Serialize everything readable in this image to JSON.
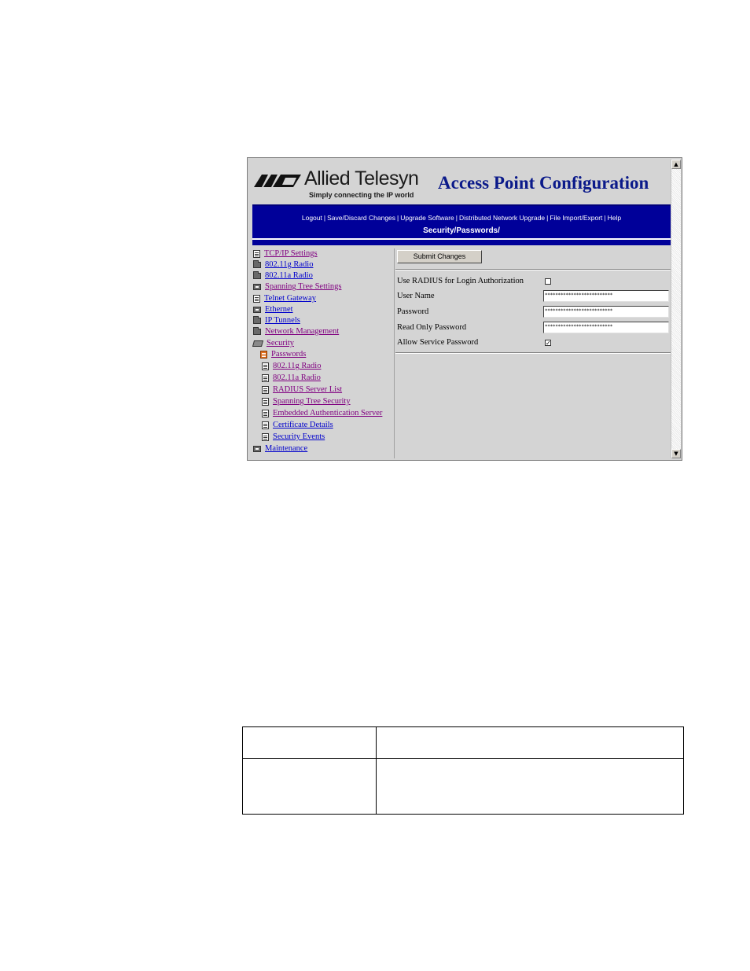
{
  "header": {
    "logo_name": "Allied Telesyn",
    "logo_tagline": "Simply connecting the IP world",
    "app_title": "Access Point Configuration"
  },
  "nav": {
    "links": [
      "Logout",
      "Save/Discard Changes",
      "Upgrade Software",
      "Distributed Network Upgrade",
      "File Import/Export",
      "Help"
    ],
    "separator": "|"
  },
  "breadcrumb": "Security/Passwords/",
  "tree": {
    "items": [
      {
        "label": "TCP/IP Settings",
        "icon": "page-icon",
        "color": "#800080"
      },
      {
        "label": "802.11g Radio",
        "icon": "folder-icon",
        "color": "#0000cc"
      },
      {
        "label": "802.11a Radio",
        "icon": "folder-icon",
        "color": "#0000cc"
      },
      {
        "label": "Spanning Tree Settings",
        "icon": "folder-plus-icon",
        "color": "#800080"
      },
      {
        "label": "Telnet Gateway",
        "icon": "page-icon",
        "color": "#0000cc"
      },
      {
        "label": "Ethernet",
        "icon": "folder-plus-icon",
        "color": "#0000cc"
      },
      {
        "label": "IP Tunnels",
        "icon": "folder-icon",
        "color": "#0000cc"
      },
      {
        "label": "Network Management",
        "icon": "folder-icon",
        "color": "#800080"
      },
      {
        "label": "Security",
        "icon": "folder-open-icon",
        "color": "#800080"
      },
      {
        "label": "Passwords",
        "icon": "page-selected-icon",
        "color": "#800080"
      },
      {
        "label": "802.11g Radio",
        "icon": "page-icon",
        "color": "#800080"
      },
      {
        "label": "802.11a Radio",
        "icon": "page-icon",
        "color": "#800080"
      },
      {
        "label": "RADIUS Server List",
        "icon": "page-icon",
        "color": "#800080"
      },
      {
        "label": "Spanning Tree Security",
        "icon": "page-icon",
        "color": "#800080"
      },
      {
        "label": "Embedded Authentication Server",
        "icon": "page-icon",
        "color": "#800080"
      },
      {
        "label": "Certificate Details",
        "icon": "page-icon",
        "color": "#0000cc"
      },
      {
        "label": "Security Events",
        "icon": "page-icon",
        "color": "#0000cc"
      },
      {
        "label": "Maintenance",
        "icon": "folder-plus-icon",
        "color": "#0000cc"
      }
    ]
  },
  "form": {
    "submit_label": "Submit Changes",
    "use_radius_label": "Use RADIUS for Login Authorization",
    "use_radius_checked": false,
    "user_name_label": "User Name",
    "user_name_value": "**************************",
    "password_label": "Password",
    "password_value": "**************************",
    "read_only_password_label": "Read Only Password",
    "read_only_password_value": "**************************",
    "allow_service_password_label": "Allow Service Password",
    "allow_service_password_checked": true
  },
  "colors": {
    "nav_bg": "#000099",
    "title": "#0b1a8a",
    "link_blue": "#0000cc",
    "link_visited": "#800080",
    "selected_icon": "#e07020"
  }
}
